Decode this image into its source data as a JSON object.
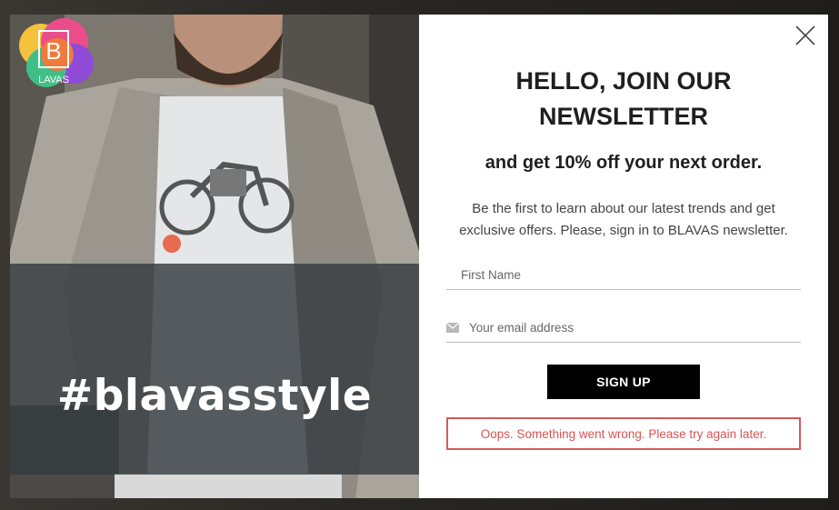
{
  "popup": {
    "hashtag": "#blavasstyle",
    "logo_text": "LAVAS",
    "logo_letter": "B",
    "headline_line1": "HELLO, JOIN OUR",
    "headline_line2": "NEWSLETTER",
    "subheadline": "and get 10% off your next order.",
    "description": "Be the first to learn about our latest trends and get exclusive offers. Please, sign in to BLAVAS newsletter.",
    "first_name_placeholder": "First Name",
    "email_placeholder": "Your email address",
    "signup_label": "SIGN UP",
    "error_message": "Oops. Something went wrong. Please try again later."
  },
  "icons": {
    "close": "close-icon",
    "email": "envelope-icon"
  },
  "colors": {
    "button_bg": "#000000",
    "error_border": "#d45a5e",
    "error_text": "#d9534f",
    "overlay": "#343a3e"
  }
}
